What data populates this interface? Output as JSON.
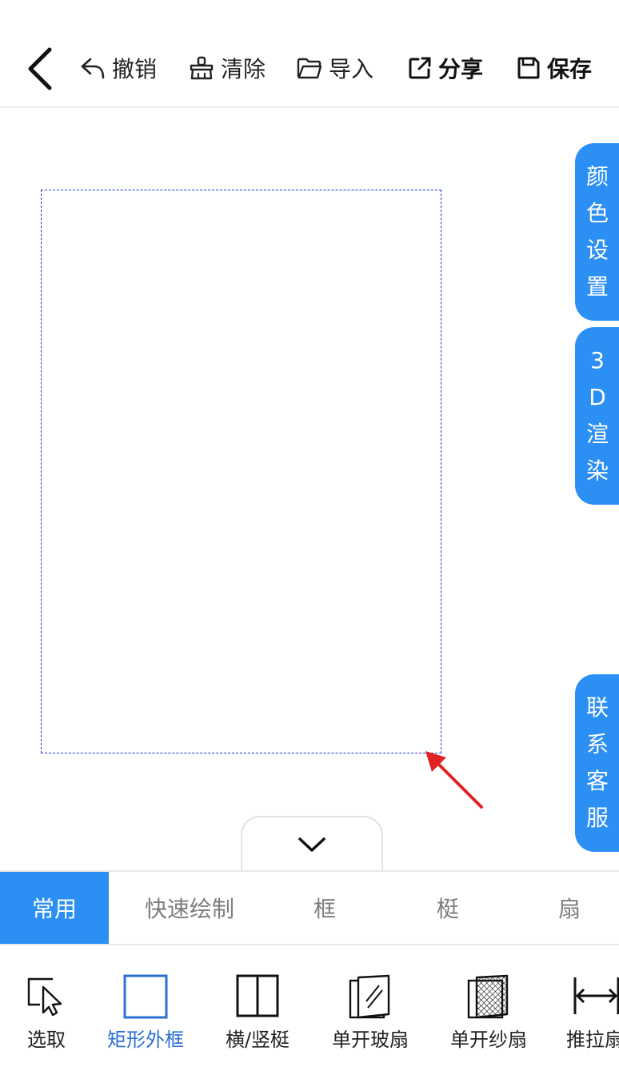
{
  "toolbar": {
    "undo_label": "撤销",
    "clear_label": "清除",
    "import_label": "导入",
    "share_label": "分享",
    "save_label": "保存"
  },
  "side_tabs": {
    "color_settings": [
      "颜",
      "色",
      "设",
      "置"
    ],
    "render_3d": [
      "3",
      "D",
      "渲",
      "染"
    ],
    "contact_service": [
      "联",
      "系",
      "客",
      "服"
    ]
  },
  "tabs": [
    {
      "label": "常用",
      "active": true
    },
    {
      "label": "快速绘制",
      "active": false
    },
    {
      "label": "框",
      "active": false
    },
    {
      "label": "梃",
      "active": false
    },
    {
      "label": "扇",
      "active": false
    }
  ],
  "tools": [
    {
      "label": "选取",
      "icon": "pointer-icon"
    },
    {
      "label": "矩形外框",
      "icon": "rectangle-frame-icon",
      "selected": true
    },
    {
      "label": "横/竖梃",
      "icon": "mullion-icon"
    },
    {
      "label": "单开玻扇",
      "icon": "glass-sash-icon"
    },
    {
      "label": "单开纱扇",
      "icon": "screen-sash-icon"
    },
    {
      "label": "推拉扇",
      "icon": "sliding-sash-icon"
    }
  ],
  "colors": {
    "accent": "#2b8ff3",
    "frame_outline": "#2233dd",
    "arrow": "#e02424",
    "selected_tool": "#2b6fd0"
  }
}
